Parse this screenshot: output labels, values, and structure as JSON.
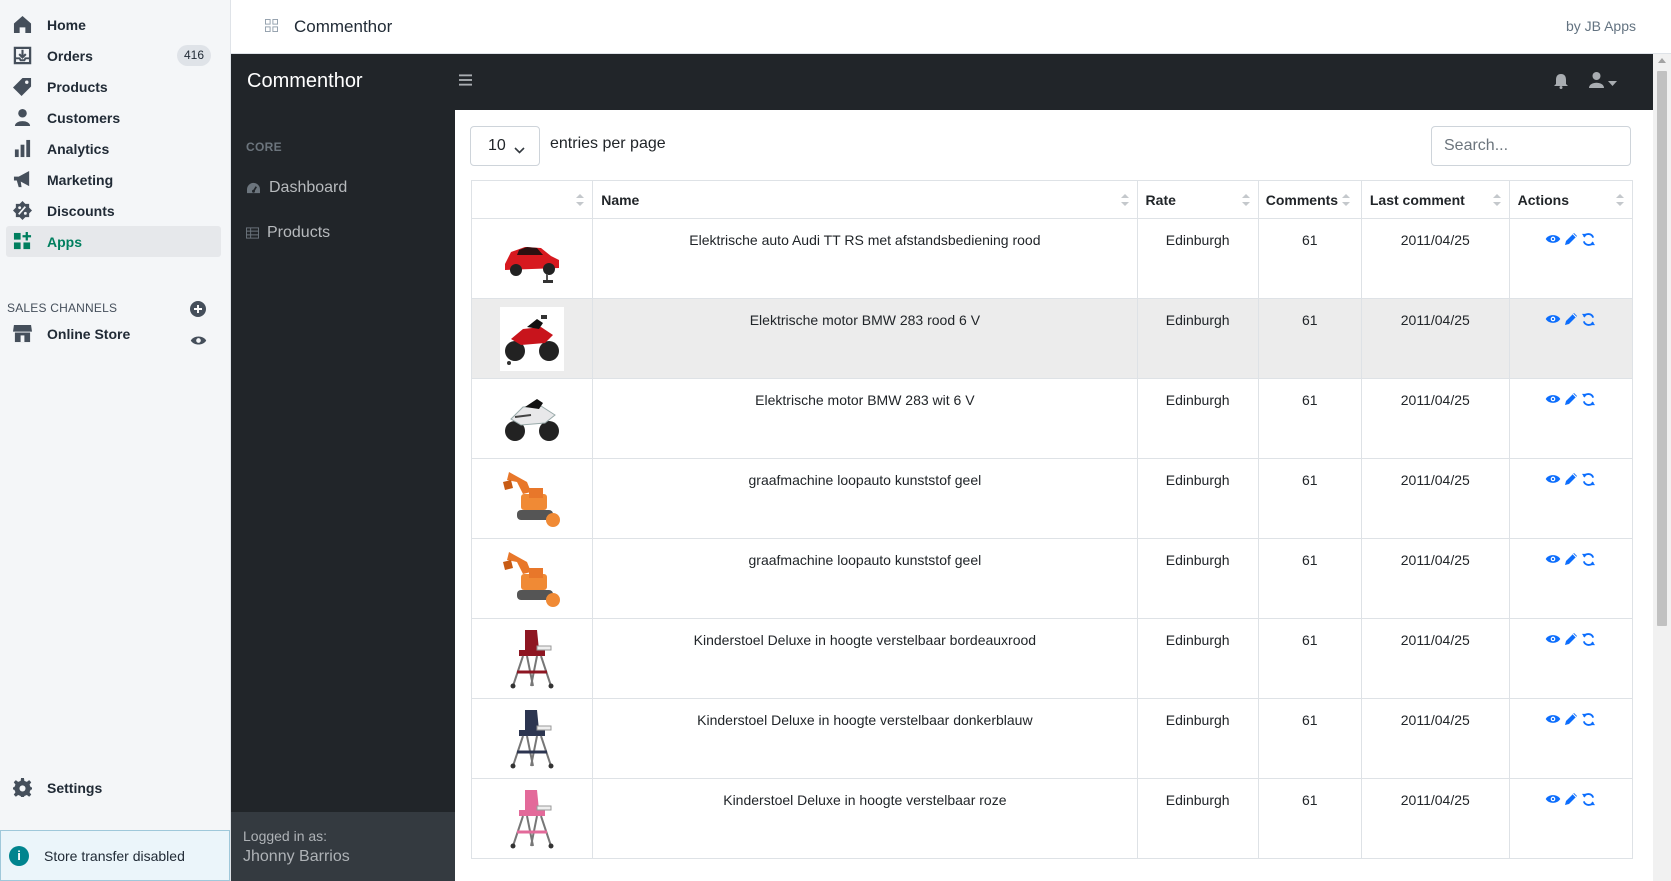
{
  "sidebar": {
    "items": [
      {
        "label": "Home",
        "icon": "home-icon"
      },
      {
        "label": "Orders",
        "icon": "orders-icon",
        "badge": "416"
      },
      {
        "label": "Products",
        "icon": "tag-icon"
      },
      {
        "label": "Customers",
        "icon": "person-icon"
      },
      {
        "label": "Analytics",
        "icon": "bar-chart-icon"
      },
      {
        "label": "Marketing",
        "icon": "megaphone-icon"
      },
      {
        "label": "Discounts",
        "icon": "discount-icon"
      },
      {
        "label": "Apps",
        "icon": "apps-icon",
        "active": true
      }
    ],
    "sales_channels_label": "SALES CHANNELS",
    "online_store": "Online Store",
    "settings": "Settings",
    "store_transfer": "Store transfer disabled"
  },
  "topbar": {
    "app_title": "Commenthor",
    "by": "by JB Apps"
  },
  "app": {
    "brand": "Commenthor",
    "sidenav": {
      "core_heading": "CORE",
      "links": [
        "Dashboard",
        "Products"
      ],
      "footer_label": "Logged in as:",
      "footer_user": "Jhonny Barrios"
    },
    "toolbar": {
      "entries_value": "10",
      "entries_label": "entries per page",
      "search_placeholder": "Search..."
    },
    "table": {
      "columns": [
        "",
        "Name",
        "Rate",
        "Comments",
        "Last comment",
        "Actions"
      ],
      "rows": [
        {
          "name": "Elektrische auto Audi TT RS met afstandsbediening rood",
          "rate": "Edinburgh",
          "comments": "61",
          "last": "2011/04/25",
          "thumb": "red-car"
        },
        {
          "name": "Elektrische motor BMW 283 rood 6 V",
          "rate": "Edinburgh",
          "comments": "61",
          "last": "2011/04/25",
          "thumb": "red-motorbike"
        },
        {
          "name": "Elektrische motor BMW 283 wit 6 V",
          "rate": "Edinburgh",
          "comments": "61",
          "last": "2011/04/25",
          "thumb": "white-motorbike"
        },
        {
          "name": "graafmachine loopauto kunststof geel",
          "rate": "Edinburgh",
          "comments": "61",
          "last": "2011/04/25",
          "thumb": "excavator"
        },
        {
          "name": "graafmachine loopauto kunststof geel",
          "rate": "Edinburgh",
          "comments": "61",
          "last": "2011/04/25",
          "thumb": "excavator"
        },
        {
          "name": "Kinderstoel Deluxe in hoogte verstelbaar bordeauxrood",
          "rate": "Edinburgh",
          "comments": "61",
          "last": "2011/04/25",
          "thumb": "chair-red"
        },
        {
          "name": "Kinderstoel Deluxe in hoogte verstelbaar donkerblauw",
          "rate": "Edinburgh",
          "comments": "61",
          "last": "2011/04/25",
          "thumb": "chair-blue"
        },
        {
          "name": "Kinderstoel Deluxe in hoogte verstelbaar roze",
          "rate": "Edinburgh",
          "comments": "61",
          "last": "2011/04/25",
          "thumb": "chair-pink"
        }
      ]
    }
  },
  "colors": {
    "accent_green": "#007f5f",
    "dark_nav": "#212529",
    "action_blue": "#0d6efd"
  }
}
